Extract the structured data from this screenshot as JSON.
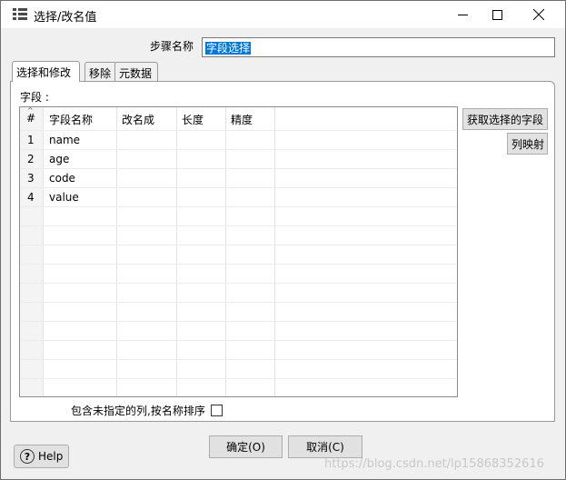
{
  "window": {
    "title": "选择/改名值",
    "minimize_icon": "minimize-icon",
    "maximize_icon": "maximize-icon",
    "close_icon": "close-icon"
  },
  "step": {
    "label": "步骤名称",
    "value": "字段选择"
  },
  "tabs": [
    {
      "label": "选择和修改",
      "active": true
    },
    {
      "label": "移除",
      "active": false
    },
    {
      "label": "元数据",
      "active": false
    }
  ],
  "fields": {
    "label": "字段 :",
    "columns": [
      "#",
      "字段名称",
      "改名成",
      "长度",
      "精度"
    ],
    "rows": [
      {
        "num": "1",
        "name": "name"
      },
      {
        "num": "2",
        "name": "age"
      },
      {
        "num": "3",
        "name": "code"
      },
      {
        "num": "4",
        "name": "value"
      }
    ]
  },
  "side_buttons": {
    "get_fields": "获取选择的字段",
    "column_mapping": "列映射"
  },
  "include_unspecified": {
    "label": "包含未指定的列,按名称排序",
    "checked": false
  },
  "buttons": {
    "ok": "确定(O)",
    "cancel": "取消(C)",
    "help": "Help"
  },
  "watermark": "https://blog.csdn.net/lp15868352616"
}
